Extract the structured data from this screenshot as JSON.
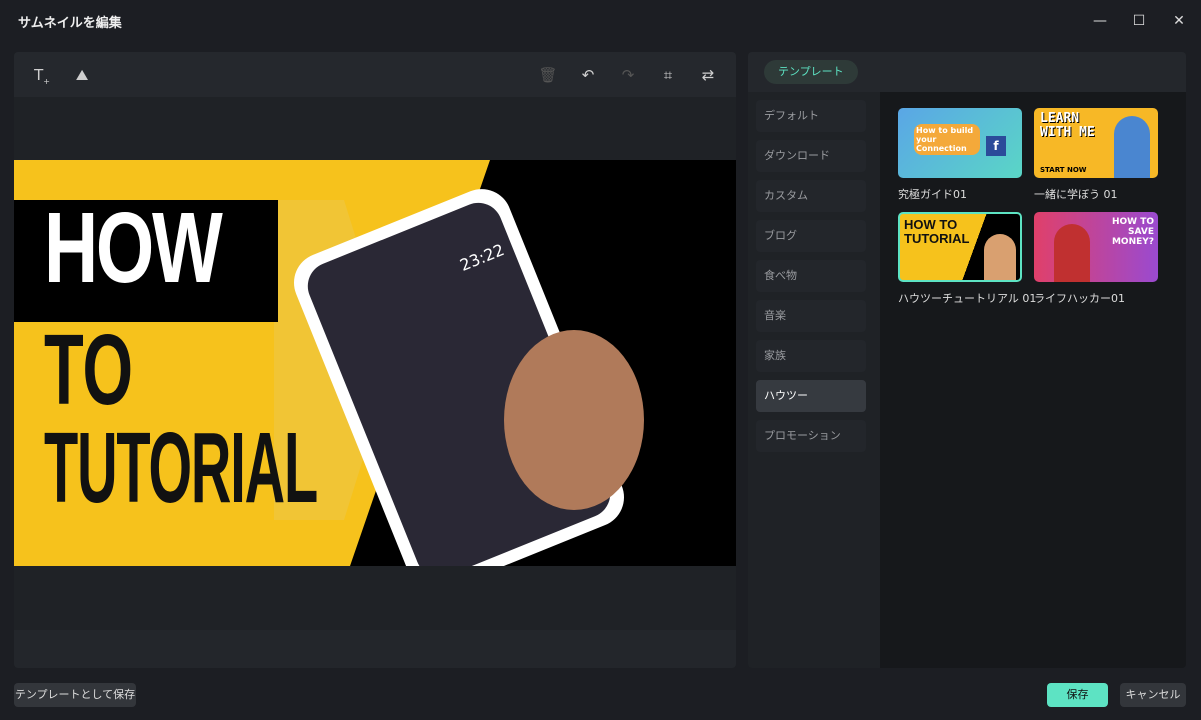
{
  "window": {
    "title": "サムネイルを編集",
    "minimize": "—",
    "maximize": "☐",
    "close": "✕"
  },
  "toolbar": {
    "icons": [
      "add-text-icon",
      "add-image-icon",
      "delete-icon",
      "undo-icon",
      "redo-icon",
      "crop-icon",
      "replace-icon"
    ]
  },
  "canvas": {
    "line1": "HOW",
    "line2": "TO",
    "line3": "TUTORIAL",
    "phone_time": "23:22"
  },
  "panel": {
    "tab": "テンプレート",
    "categories": [
      "デフォルト",
      "ダウンロード",
      "カスタム",
      "ブログ",
      "食べ物",
      "音楽",
      "家族",
      "ハウツー",
      "プロモーション"
    ],
    "active_category": "ハウツー",
    "templates": [
      {
        "label": "究極ガイド01",
        "text": "How to build your Connection"
      },
      {
        "label": "一緒に学ぼう 01",
        "text": "LEARN WITH ME",
        "sub": "START NOW"
      },
      {
        "label": "ハウツーチュートリアル 01",
        "text": "HOW TO TUTORIAL"
      },
      {
        "label": "ライフハッカー01",
        "text": "HOW TO SAVE MONEY?"
      }
    ]
  },
  "footer": {
    "save_template": "テンプレートとして保存",
    "save": "保存",
    "cancel": "キャンセル"
  },
  "colors": {
    "accent": "#5de3c3",
    "selected_border": "#5de3c3"
  }
}
